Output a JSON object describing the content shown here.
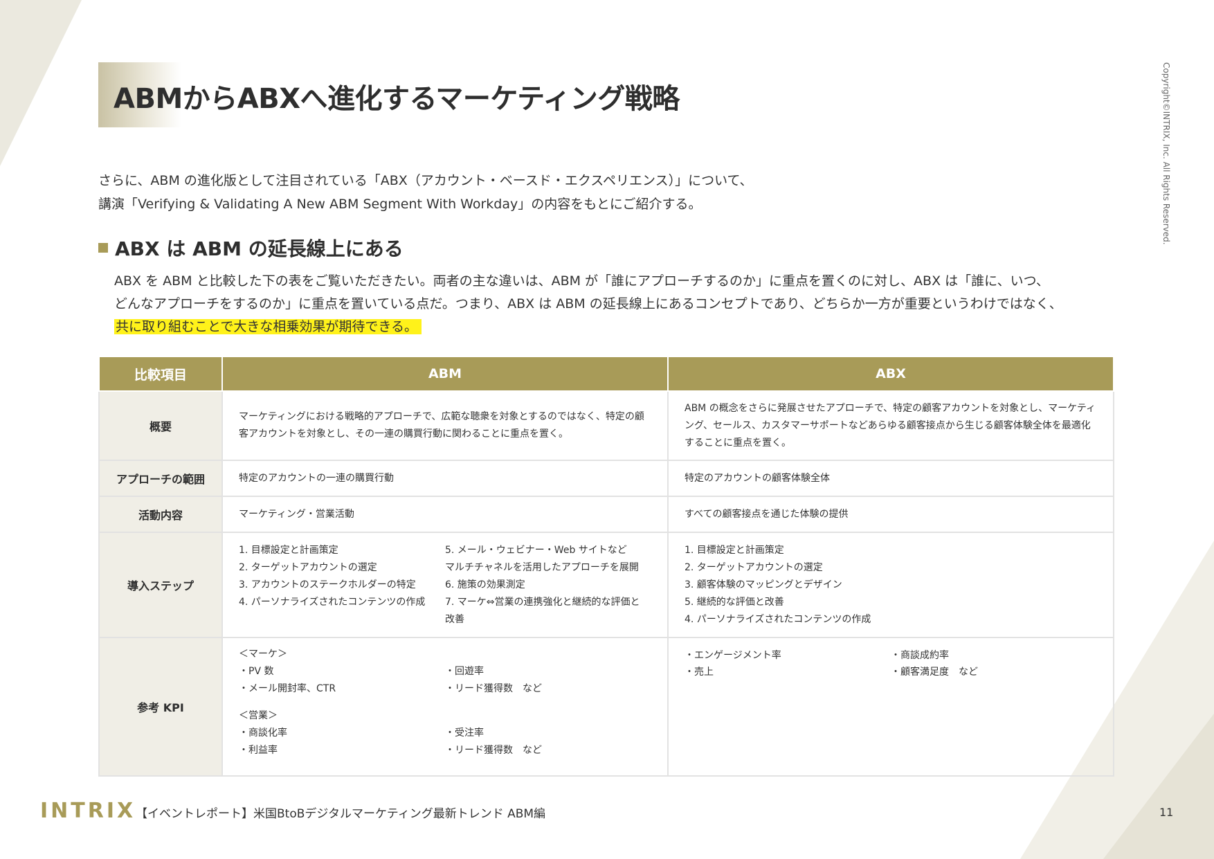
{
  "page": {
    "title": "ABMからABXへ進化するマーケティング戦略",
    "copyright": "Copyright©INTRIX, Inc. All Rights Reserved.",
    "intro": [
      "さらに、ABM の進化版として注目されている「ABX（アカウント・ベースド・エクスペリエンス）」について、",
      "講演「Verifying & Validating A New ABM Segment With Workday」の内容をもとにご紹介する。"
    ],
    "section_title": "ABX は ABM の延長線上にある",
    "paragraph": [
      "ABX を ABM と比較した下の表をご覧いただきたい。両者の主な違いは、ABM が「誰にアプローチするのか」に重点を置くのに対し、ABX は「誰に、いつ、",
      "どんなアプローチをするのか」に重点を置いている点だ。つまり、ABX は ABM の延長線上にあるコンセプトであり、どちらか一方が重要というわけではなく、"
    ],
    "paragraph_highlight": "共に取り組むことで大きな相乗効果が期待できる。"
  },
  "table": {
    "headers": [
      "比較項目",
      "ABM",
      "ABX"
    ],
    "rows": {
      "overview": {
        "label": "概要",
        "abm": "マーケティングにおける戦略的アプローチで、広範な聴衆を対象とするのではなく、特定の顧客アカウントを対象とし、その一連の購買行動に関わることに重点を置く。",
        "abx": "ABM の概念をさらに発展させたアプローチで、特定の顧客アカウントを対象とし、マーケティング、セールス、カスタマーサポートなどあらゆる顧客接点から生じる顧客体験全体を最適化することに重点を置く。"
      },
      "scope": {
        "label": "アプローチの範囲",
        "abm": "特定のアカウントの一連の購買行動",
        "abx": "特定のアカウントの顧客体験全体"
      },
      "activity": {
        "label": "活動内容",
        "abm": "マーケティング・営業活動",
        "abx": "すべての顧客接点を通じた体験の提供"
      },
      "steps": {
        "label": "導入ステップ",
        "abm_col1": [
          "1. 目標設定と計画策定",
          "2. ターゲットアカウントの選定",
          "3. アカウントのステークホルダーの特定",
          "4. パーソナライズされたコンテンツの作成"
        ],
        "abm_col2": [
          "5. メール・ウェビナー・Web サイトなど",
          "マルチチャネルを活用したアプローチを展開",
          "6. 施策の効果測定",
          "7. マーケ⇔営業の連携強化と継続的な評価と",
          "改善"
        ],
        "abx": [
          "1. 目標設定と計画策定",
          "2. ターゲットアカウントの選定",
          "3. 顧客体験のマッピングとデザイン",
          "5. 継続的な評価と改善",
          "4. パーソナライズされたコンテンツの作成"
        ]
      },
      "kpi": {
        "label": "参考 KPI",
        "abm_marketing_head": "＜マーケ＞",
        "abm_marketing_col1": [
          "・PV 数",
          "・メール開封率、CTR"
        ],
        "abm_marketing_col2": [
          "・回遊率",
          "・リード獲得数　など"
        ],
        "abm_sales_head": "＜営業＞",
        "abm_sales_col1": [
          "・商談化率",
          "・利益率"
        ],
        "abm_sales_col2": [
          "・受注率",
          "・リード獲得数　など"
        ],
        "abx_col1": [
          "・エンゲージメント率",
          "・売上"
        ],
        "abx_col2": [
          "・商談成約率",
          "・顧客満足度　など"
        ]
      }
    }
  },
  "footer": {
    "logo": "INTRIX",
    "text": "【イベントレポート】米国BtoBデジタルマーケティング最新トレンド ABM編",
    "page_number": "11"
  },
  "colors": {
    "accent": "#a89b58",
    "row_label_bg": "#f0eee6",
    "highlight": "#fff21a"
  }
}
